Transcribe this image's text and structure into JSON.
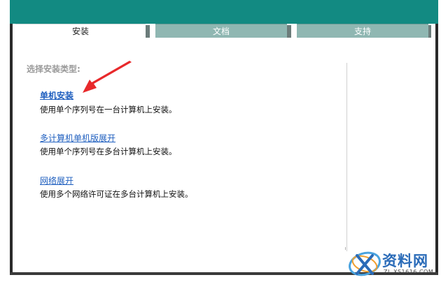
{
  "tabs": {
    "install": "安装",
    "docs": "文档",
    "support": "支持"
  },
  "main": {
    "heading": "选择安装类型:",
    "options": [
      {
        "label": "单机安装",
        "description": "使用单个序列号在一台计算机上安装。"
      },
      {
        "label": "多计算机单机版展开",
        "description": "使用单个序列号在多台计算机上安装。"
      },
      {
        "label": "网络展开",
        "description": "使用多个网络许可证在多台计算机上安装。"
      }
    ]
  },
  "watermark": {
    "title": "资料网",
    "url": "ZL.XS1616.COM"
  },
  "colors": {
    "teal": "#128a82",
    "tab_inactive": "#8fb7b2",
    "link": "#1f5fbf",
    "arrow": "#e8292b"
  }
}
